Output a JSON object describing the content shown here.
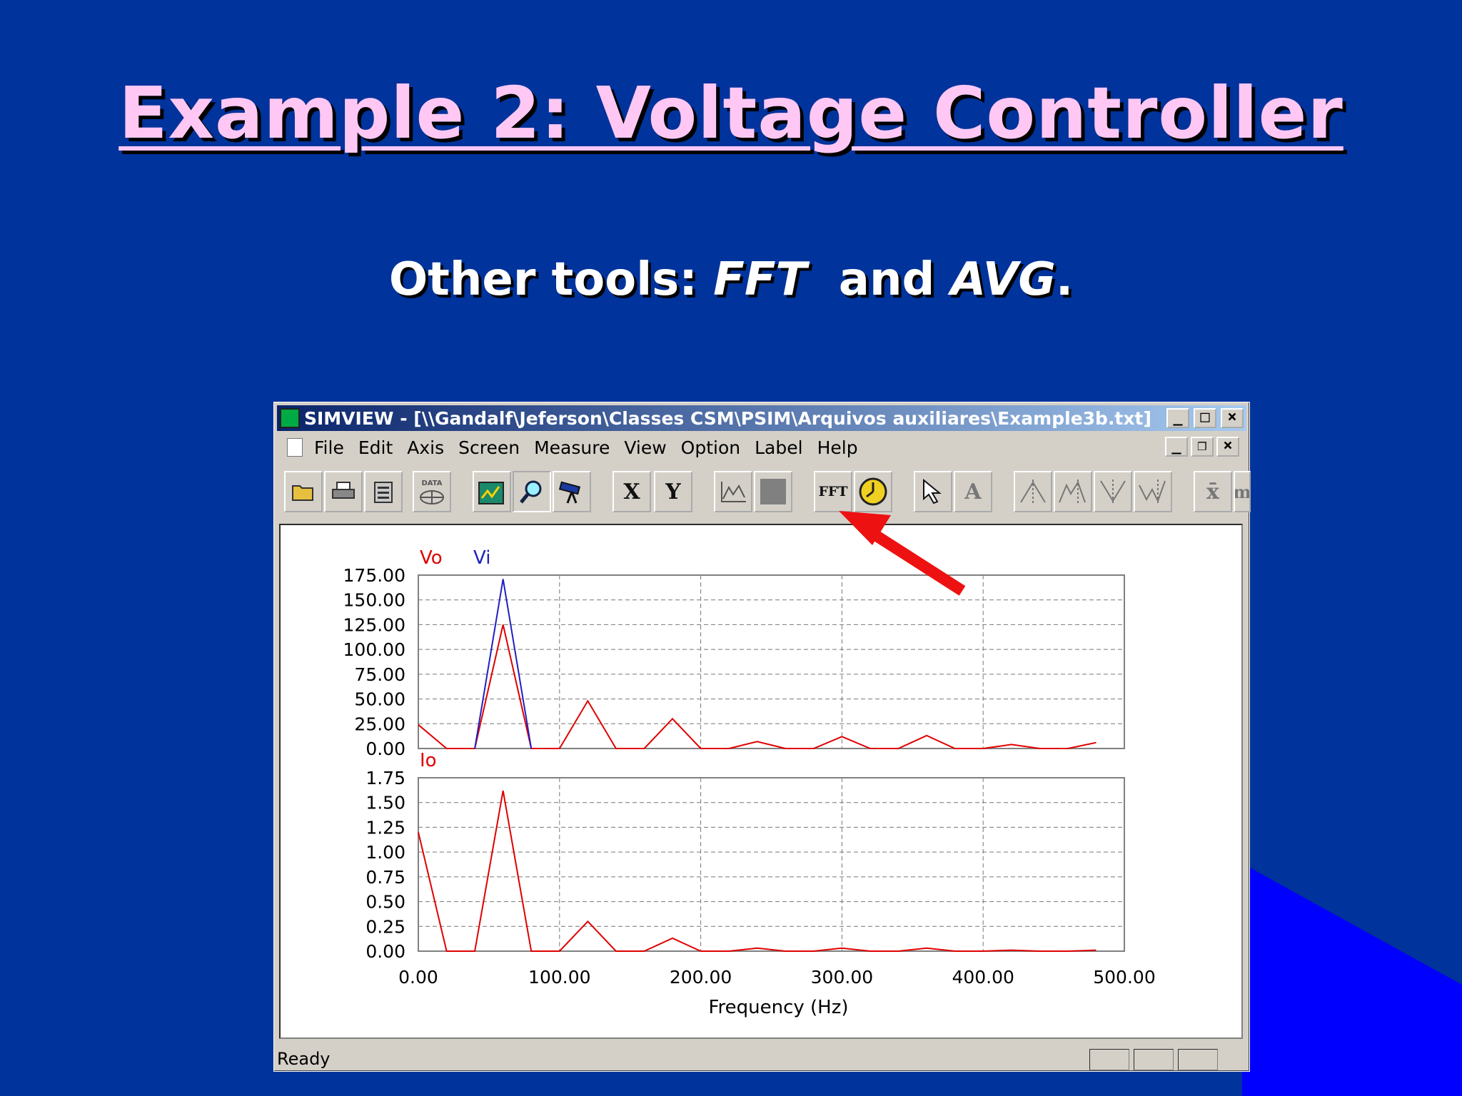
{
  "slide": {
    "title": "Example 2: Voltage Controller",
    "subtitle_prefix": "Other tools: ",
    "subtitle_fft": "FFT",
    "subtitle_and": "  and ",
    "subtitle_avg": "AVG",
    "subtitle_end": "."
  },
  "window": {
    "title": "SIMVIEW - [\\\\Gandalf\\Jeferson\\Classes CSM\\PSIM\\Arquivos auxiliares\\Example3b.txt]",
    "controls": [
      "_",
      "□",
      "×"
    ],
    "mdi_controls": [
      "_",
      "❐",
      "×"
    ]
  },
  "menu": [
    "File",
    "Edit",
    "Axis",
    "Screen",
    "Measure",
    "View",
    "Option",
    "Label",
    "Help"
  ],
  "toolbar": {
    "x_label": "X",
    "y_label": "Y",
    "fft_label": "FFT",
    "text_label": "A",
    "xbar_label": "x̄",
    "m_label": "m",
    "data_label": "DATA"
  },
  "status": {
    "text": "Ready"
  },
  "colors": {
    "slide_bg": "#00339b",
    "corner_blue": "#0000ff",
    "series_red": "#e00000",
    "series_blue": "#2020c0",
    "arrow": "#ee1111"
  },
  "chart_data": [
    {
      "type": "line",
      "xlabel": "",
      "ylabel": "",
      "legend": [
        "Vo",
        "Vi"
      ],
      "ylim": [
        0,
        175
      ],
      "xlim": [
        0,
        500
      ],
      "yticks": [
        "175.00",
        "150.00",
        "125.00",
        "100.00",
        "75.00",
        "50.00",
        "25.00",
        "0.00"
      ],
      "grid": true,
      "series": [
        {
          "name": "Vo",
          "x": [
            0,
            20,
            40,
            60,
            80,
            100,
            120,
            140,
            160,
            180,
            200,
            220,
            240,
            260,
            280,
            300,
            320,
            340,
            360,
            380,
            400,
            420,
            440,
            460,
            480
          ],
          "y": [
            24,
            0,
            0,
            125,
            0,
            0,
            48,
            0,
            0,
            30,
            0,
            0,
            7,
            0,
            0,
            12,
            0,
            0,
            13,
            0,
            0,
            4,
            0,
            0,
            6
          ]
        },
        {
          "name": "Vi",
          "x": [
            40,
            60,
            80
          ],
          "y": [
            0,
            171,
            0
          ]
        }
      ]
    },
    {
      "type": "line",
      "xlabel": "Frequency (Hz)",
      "ylabel": "",
      "legend": [
        "Io"
      ],
      "ylim": [
        0,
        1.75
      ],
      "xlim": [
        0,
        500
      ],
      "yticks": [
        "1.75",
        "1.50",
        "1.25",
        "1.00",
        "0.75",
        "0.50",
        "0.25",
        "0.00"
      ],
      "xticks": [
        "0.00",
        "100.00",
        "200.00",
        "300.00",
        "400.00",
        "500.00"
      ],
      "grid": true,
      "series": [
        {
          "name": "Io",
          "x": [
            0,
            20,
            40,
            60,
            80,
            100,
            120,
            140,
            160,
            180,
            200,
            220,
            240,
            260,
            280,
            300,
            320,
            340,
            360,
            380,
            400,
            420,
            440,
            460,
            480
          ],
          "y": [
            1.2,
            0,
            0,
            1.62,
            0,
            0,
            0.3,
            0,
            0,
            0.13,
            0,
            0,
            0.03,
            0,
            0,
            0.03,
            0,
            0,
            0.03,
            0,
            0,
            0.01,
            0,
            0,
            0.01
          ]
        }
      ]
    }
  ]
}
